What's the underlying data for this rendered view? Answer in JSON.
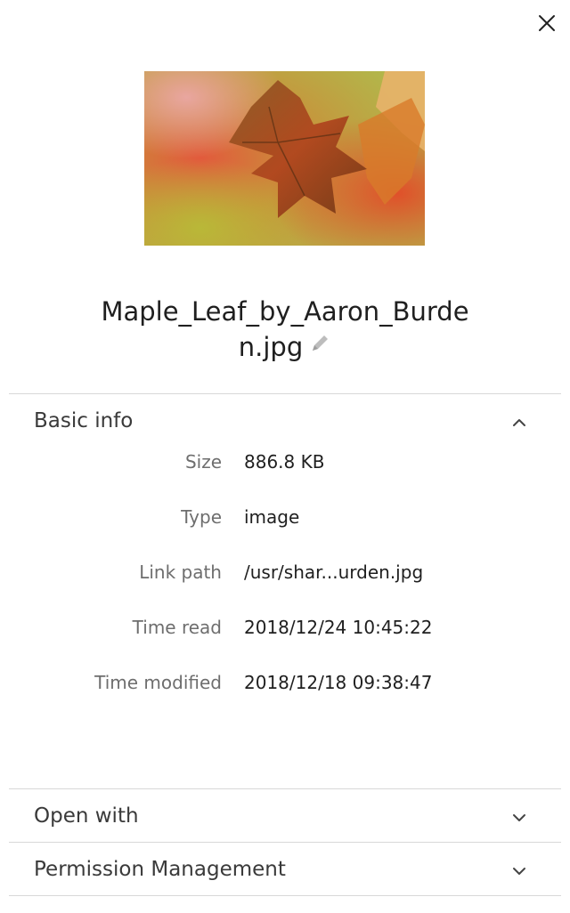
{
  "dialog": {
    "filename": "Maple_Leaf_by_Aaron_Burden.jpg",
    "close_icon": "close-icon",
    "edit_icon": "pencil-icon"
  },
  "basic_info": {
    "title": "Basic info",
    "expanded": true,
    "rows": [
      {
        "key": "Size",
        "value": "886.8 KB"
      },
      {
        "key": "Type",
        "value": "image"
      },
      {
        "key": "Link path",
        "value": "/usr/shar...urden.jpg"
      },
      {
        "key": "Time read",
        "value": "2018/12/24 10:45:22"
      },
      {
        "key": "Time modified",
        "value": "2018/12/18 09:38:47"
      }
    ]
  },
  "open_with": {
    "title": "Open with",
    "expanded": false
  },
  "permission": {
    "title": "Permission Management",
    "expanded": false
  },
  "colors": {
    "divider": "#d8d8d8",
    "key_text": "#6e6e6e",
    "value_text": "#1f1f1f"
  }
}
